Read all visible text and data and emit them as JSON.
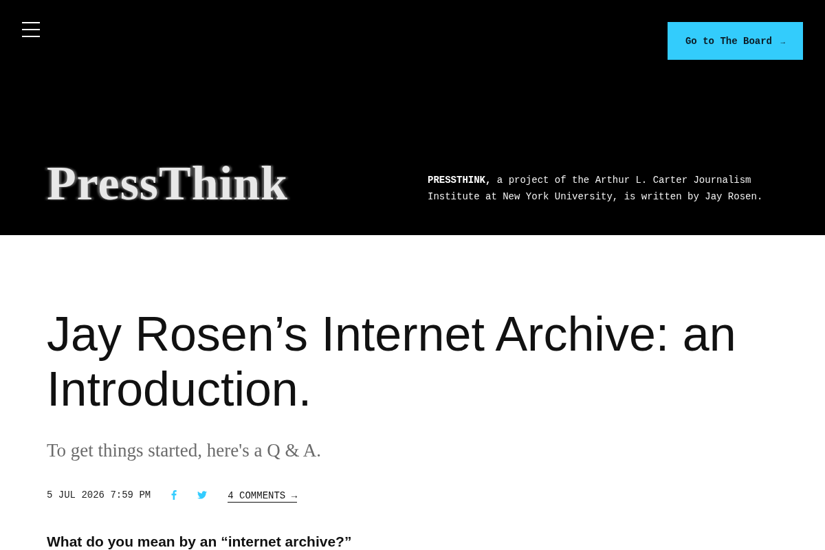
{
  "header": {
    "board_button": {
      "label": "Go to The Board",
      "arrow": "→"
    },
    "logo": {
      "text": "PressThink"
    },
    "about": "**PRESSTHINK,** a project of the Arthur L. Carter Journalism Institute at New York University, is written by Jay Rosen."
  },
  "article": {
    "title": "Jay Rosen’s Internet Archive: an Introduction.",
    "subtitle": "To get things started, here's a Q & A.",
    "date": "5 JUL 2026 7:59 PM",
    "share": [
      {
        "kind": "facebook"
      },
      {
        "kind": "twitter"
      }
    ],
    "comments_link": "4 COMMENTS →",
    "section_heading": "What do you mean by an “internet archive?”"
  }
}
